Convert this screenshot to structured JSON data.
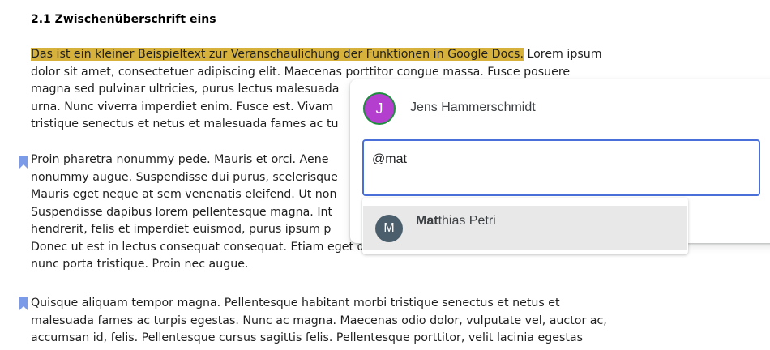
{
  "document": {
    "heading": "2.1 Zwischenüberschrift eins",
    "paragraphs": [
      {
        "highlighted": "Das ist ein kleiner Beispieltext zur Veranschaulichung der Funktionen in Google Docs.",
        "lines": [
          " Lorem ipsum",
          "dolor sit amet, consectetuer adipiscing elit. Maecenas porttitor congue massa. Fusce posuere",
          "magna sed pulvinar ultricies, purus lectus malesuada",
          "urna. Nunc viverra imperdiet enim. Fusce est. Vivam",
          "tristique senectus et netus et malesuada fames ac tu"
        ]
      },
      {
        "lines": [
          "Proin pharetra nonummy pede. Mauris et orci. Aene",
          "nonummy augue. Suspendisse dui purus, scelerisque",
          "Mauris eget neque at sem venenatis eleifend. Ut non",
          "Suspendisse dapibus lorem pellentesque magna. Int",
          "hendrerit, felis et imperdiet euismod, purus ipsum p",
          "Donec ut est in lectus consequat consequat. Etiam eget dui. Aliquam erat volutpat. Sed at",
          "nunc porta tristique. Proin nec augue."
        ]
      },
      {
        "lines": [
          "Quisque aliquam tempor magna. Pellentesque habitant morbi tristique senectus et netus et",
          "malesuada fames ac turpis egestas. Nunc ac magna. Maecenas odio dolor, vulputate vel, auctor ac,",
          "accumsan id, felis. Pellentesque cursus sagittis felis. Pellentesque porttitor, velit lacinia egestas"
        ]
      }
    ]
  },
  "comment": {
    "avatar_initial": "J",
    "author": "Jens Hammerschmidt",
    "input_value": "@mat"
  },
  "mention_suggestion": {
    "avatar_initial": "M",
    "name_match": "Mat",
    "name_rest": "thias Petri"
  },
  "colors": {
    "highlight": "#d6b23c",
    "bookmark": "#7b9ae8",
    "input_focus": "#4a6fd8",
    "author_avatar": "#b43fcf",
    "suggestion_avatar": "#4b5e6b"
  },
  "icons": {
    "paragraph_marker": "bookmark-icon"
  }
}
